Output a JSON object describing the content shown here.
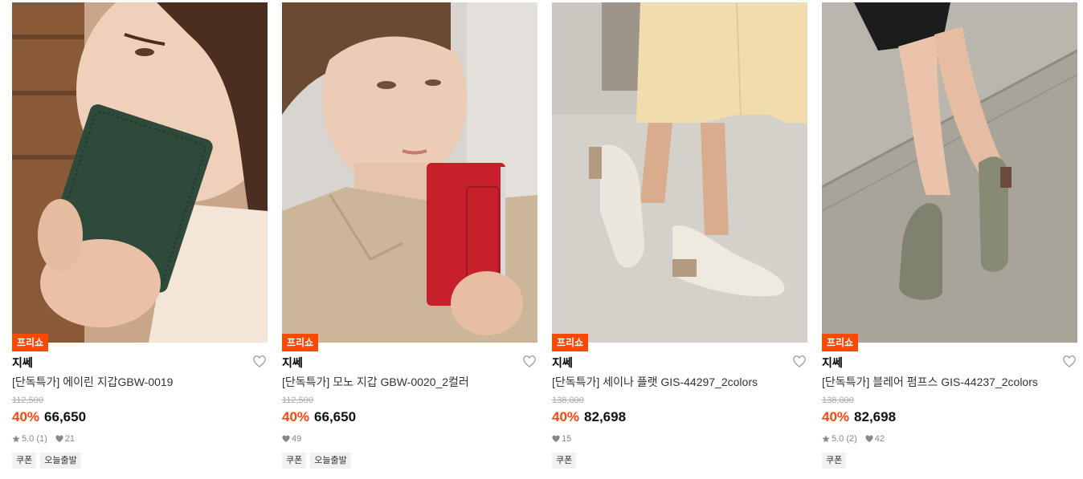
{
  "colors": {
    "accent": "#ff4800",
    "badge_text": "#ffffff"
  },
  "products": [
    {
      "badge": "프리쇼",
      "brand": "지쎄",
      "name": "[단독특가] 에이린 지갑GBW-0019",
      "original_price": "112,500",
      "discount": "40%",
      "price": "66,650",
      "rating": "5.0 (1)",
      "likes": "21",
      "tags": [
        "쿠폰",
        "오늘출발"
      ],
      "image": "green-leather-wallet-photo",
      "wishlist_icon": "heart-outline-icon"
    },
    {
      "badge": "프리쇼",
      "brand": "지쎄",
      "name": "[단독특가] 모노 지갑 GBW-0020_2컬러",
      "original_price": "112,500",
      "discount": "40%",
      "price": "66,650",
      "rating": "",
      "likes": "49",
      "tags": [
        "쿠폰",
        "오늘출발"
      ],
      "image": "red-card-wallet-photo",
      "wishlist_icon": "heart-outline-icon"
    },
    {
      "badge": "프리쇼",
      "brand": "지쎄",
      "name": "[단독특가] 세이나 플랫 GIS-44297_2colors",
      "original_price": "138,000",
      "discount": "40%",
      "price": "82,698",
      "rating": "",
      "likes": "15",
      "tags": [
        "쿠폰"
      ],
      "image": "white-flat-shoes-photo",
      "wishlist_icon": "heart-outline-icon"
    },
    {
      "badge": "프리쇼",
      "brand": "지쎄",
      "name": "[단독특가] 블레어 펌프스 GIS-44237_2colors",
      "original_price": "138,000",
      "discount": "40%",
      "price": "82,698",
      "rating": "5.0 (2)",
      "likes": "42",
      "tags": [
        "쿠폰"
      ],
      "image": "olive-pumps-photo",
      "wishlist_icon": "heart-outline-icon"
    }
  ]
}
